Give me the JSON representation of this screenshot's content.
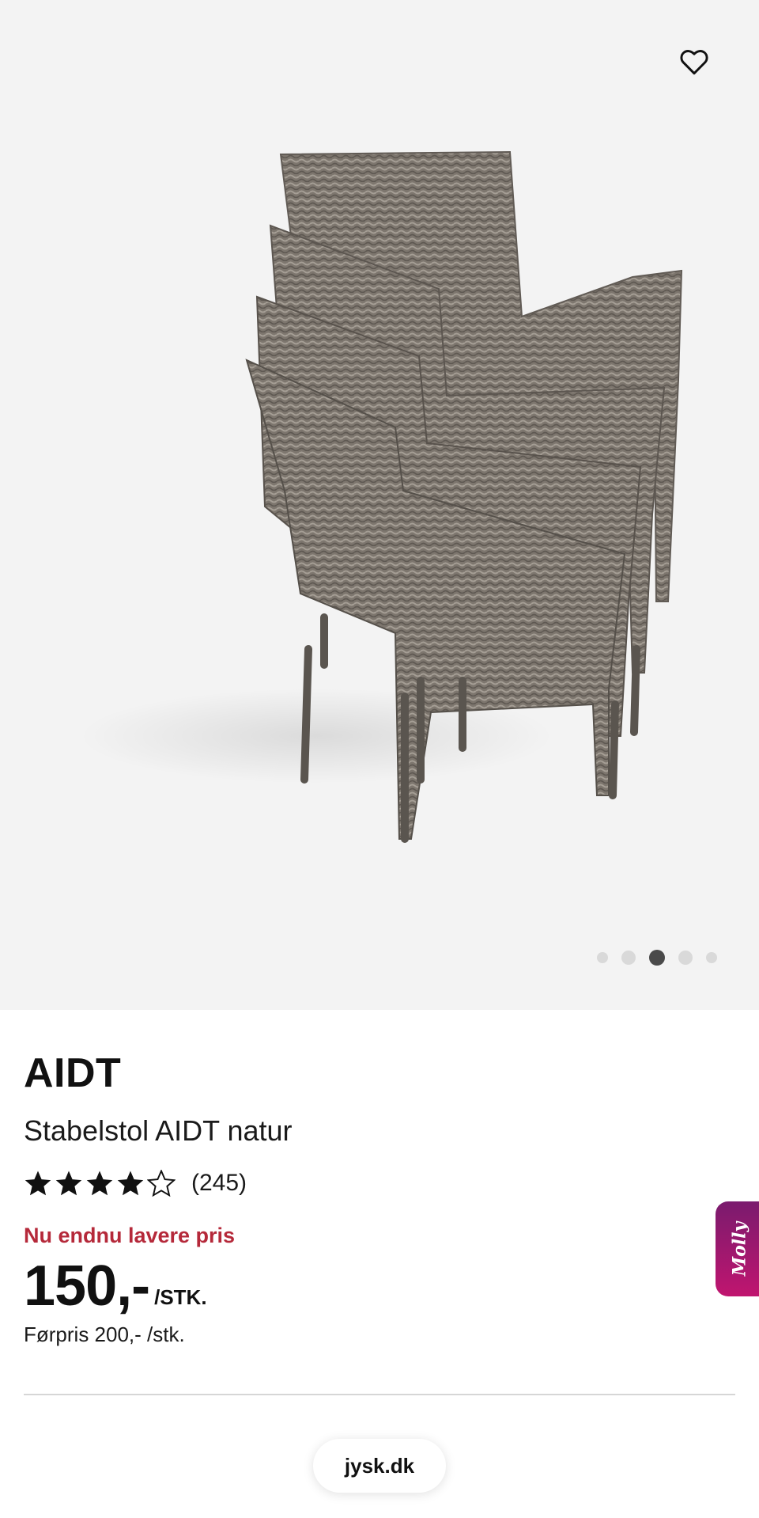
{
  "gallery": {
    "image_alt": "Stabelstol AIDT natur",
    "dots_count": 5,
    "active_dot_index": 2
  },
  "product": {
    "brand": "AIDT",
    "name": "Stabelstol AIDT natur",
    "rating": 4,
    "rating_max": 5,
    "rating_count": "(245)",
    "promo_text": "Nu endnu lavere pris",
    "price": "150,-",
    "price_unit": "/STK.",
    "before_price": "Førpris 200,- /stk."
  },
  "widget": {
    "molly_label": "Molly"
  },
  "browser": {
    "url": "jysk.dk"
  },
  "colors": {
    "promo_red": "#b5293a",
    "gallery_bg": "#f3f3f3",
    "molly_gradient_start": "#7a1b6e",
    "molly_gradient_end": "#c0156f"
  },
  "icons": {
    "favorite": "heart-outline-icon",
    "star_full": "star-filled-icon",
    "star_empty": "star-outline-icon"
  }
}
